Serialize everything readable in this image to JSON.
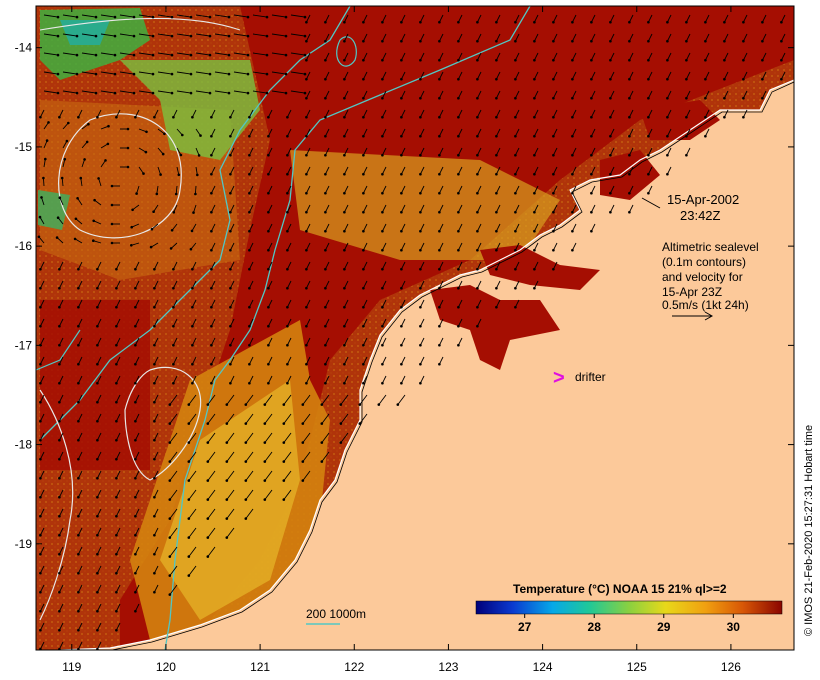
{
  "map": {
    "lon_ticks": [
      "119",
      "120",
      "121",
      "122",
      "123",
      "124",
      "125",
      "126"
    ],
    "lat_ticks": [
      "-14",
      "-15",
      "-16",
      "-17",
      "-18",
      "-19"
    ],
    "lon_range": [
      118.62,
      126.67
    ],
    "lat_range": [
      -20.07,
      -13.58
    ]
  },
  "annotations": {
    "date": "15-Apr-2002",
    "time": "23:42Z",
    "info_lines": [
      "Altimetric sealevel",
      "(0.1m contours)",
      "and velocity for",
      "15-Apr 23Z",
      "0.5m/s (1kt 24h)"
    ],
    "drifter_symbol": ">",
    "drifter_label": "drifter",
    "depth_label": "200  1000m"
  },
  "colorbar": {
    "title": "Temperature (°C) NOAA 15 21% ql>=2",
    "ticks": [
      "27",
      "28",
      "29",
      "30"
    ],
    "range": [
      26.3,
      30.7
    ]
  },
  "credit": "© IMOS 21-Feb-2020 15:27:31 Hobart time",
  "colors": {
    "land": "#fcc99a",
    "hot": "#a50e02",
    "warm": "#d27a0c",
    "yellow": "#e6b428",
    "contour": "#52c7c4",
    "drifter": "#e010e0"
  }
}
